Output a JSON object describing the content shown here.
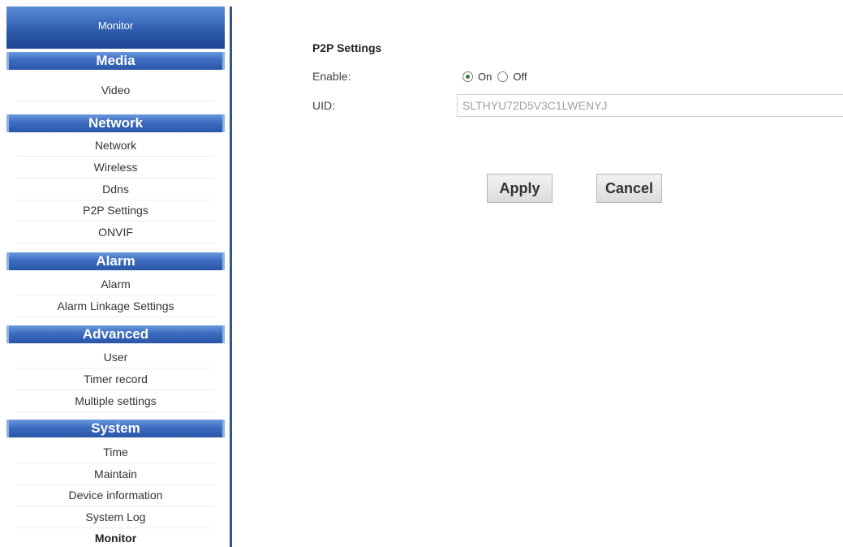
{
  "sidebar": {
    "top_tab": "Monitor",
    "sections": {
      "media": {
        "header": "Media",
        "items": [
          "Video"
        ]
      },
      "network": {
        "header": "Network",
        "items": [
          "Network",
          "Wireless",
          "Ddns",
          "P2P Settings",
          "ONVIF"
        ]
      },
      "alarm": {
        "header": "Alarm",
        "items": [
          "Alarm",
          "Alarm Linkage Settings"
        ]
      },
      "advanced": {
        "header": "Advanced",
        "items": [
          "User",
          "Timer record",
          "Multiple settings"
        ]
      },
      "system": {
        "header": "System",
        "items": [
          "Time",
          "Maintain",
          "Device information",
          "System Log",
          "Monitor"
        ]
      }
    }
  },
  "main": {
    "title": "P2P Settings",
    "enable": {
      "label": "Enable:",
      "options": [
        "On",
        "Off"
      ],
      "selected": "On"
    },
    "uid": {
      "label": "UID:",
      "value": "SLTHYU72D5V3C1LWENYJ"
    },
    "buttons": {
      "apply": "Apply",
      "cancel": "Cancel"
    }
  },
  "colors": {
    "sidebar_header": "#2b57a8",
    "sidebar_rule": "#2f5597",
    "radio_selected": "#2f7d32"
  }
}
